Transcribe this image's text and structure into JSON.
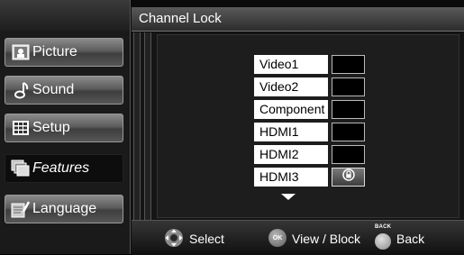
{
  "header": {
    "title": "Channel Lock"
  },
  "sidebar": {
    "items": [
      {
        "label": "Picture",
        "icon": "picture-icon",
        "active": false
      },
      {
        "label": "Sound",
        "icon": "sound-icon",
        "active": false
      },
      {
        "label": "Setup",
        "icon": "setup-icon",
        "active": false
      },
      {
        "label": "Features",
        "icon": "features-icon",
        "active": true
      },
      {
        "label": "Language",
        "icon": "language-icon",
        "active": false
      }
    ]
  },
  "channels": [
    {
      "label": "Video1",
      "locked": false
    },
    {
      "label": "Video2",
      "locked": false
    },
    {
      "label": "Component",
      "locked": false
    },
    {
      "label": "HDMI1",
      "locked": false
    },
    {
      "label": "HDMI2",
      "locked": false
    },
    {
      "label": "HDMI3",
      "locked": true
    }
  ],
  "footer": {
    "select_label": "Select",
    "ok_badge": "OK",
    "view_block_label": "View / Block",
    "back_badge": "BACK",
    "back_label": "Back"
  },
  "colors": {
    "lock_accent": "#ffffff",
    "row_label_bg": "#ffffff"
  }
}
